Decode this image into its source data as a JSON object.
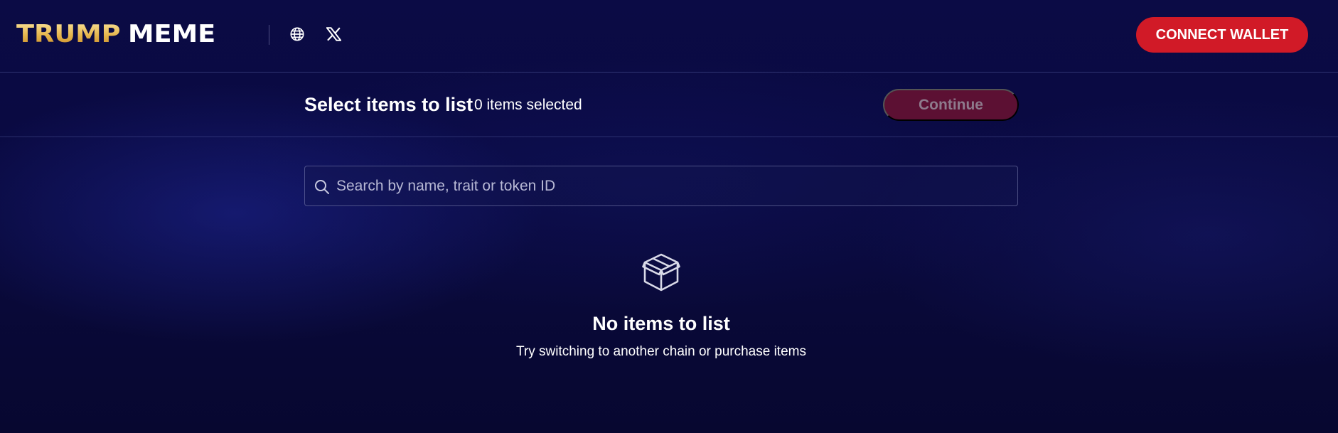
{
  "header": {
    "logo": {
      "part1": "TRUMP",
      "part2": "MEME"
    },
    "icons": [
      "globe-icon",
      "x-logo-icon"
    ],
    "connect_wallet_label": "CONNECT WALLET"
  },
  "subbar": {
    "title": "Select items to list",
    "selected_count": "0 items selected",
    "continue_label": "Continue"
  },
  "search": {
    "placeholder": "Search by name, trait or token ID",
    "value": ""
  },
  "empty_state": {
    "icon": "box-icon",
    "title": "No items to list",
    "subtitle": "Try switching to another chain or purchase items"
  },
  "colors": {
    "background": "#08083a",
    "accent": "#d11a27",
    "continue_disabled": "#5c1033",
    "logo_gold": "#e5b54c"
  }
}
